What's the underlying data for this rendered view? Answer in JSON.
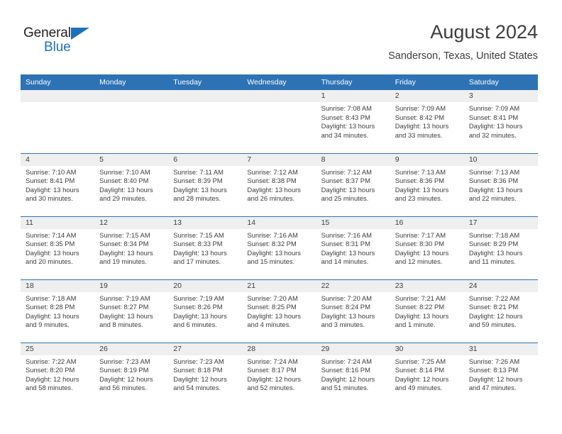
{
  "logo": {
    "word1": "General",
    "word2": "Blue",
    "triangle_color": "#1d70b8"
  },
  "header": {
    "title": "August 2024",
    "location": "Sanderson, Texas, United States"
  },
  "theme": {
    "header_blue": "#2d72b5",
    "daynum_band": "#efefef",
    "text": "#3d3d3d"
  },
  "weekday_headers": [
    "Sunday",
    "Monday",
    "Tuesday",
    "Wednesday",
    "Thursday",
    "Friday",
    "Saturday"
  ],
  "labels": {
    "sunrise_prefix": "Sunrise:",
    "sunset_prefix": "Sunset:",
    "daylight_prefix": "Daylight:"
  },
  "weeks": [
    [
      {
        "day": "",
        "empty": true
      },
      {
        "day": "",
        "empty": true
      },
      {
        "day": "",
        "empty": true
      },
      {
        "day": "",
        "empty": true
      },
      {
        "day": "1",
        "sunrise": "Sunrise: 7:08 AM",
        "sunset": "Sunset: 8:43 PM",
        "daylight": "Daylight: 13 hours and 34 minutes."
      },
      {
        "day": "2",
        "sunrise": "Sunrise: 7:09 AM",
        "sunset": "Sunset: 8:42 PM",
        "daylight": "Daylight: 13 hours and 33 minutes."
      },
      {
        "day": "3",
        "sunrise": "Sunrise: 7:09 AM",
        "sunset": "Sunset: 8:41 PM",
        "daylight": "Daylight: 13 hours and 32 minutes."
      }
    ],
    [
      {
        "day": "4",
        "sunrise": "Sunrise: 7:10 AM",
        "sunset": "Sunset: 8:41 PM",
        "daylight": "Daylight: 13 hours and 30 minutes."
      },
      {
        "day": "5",
        "sunrise": "Sunrise: 7:10 AM",
        "sunset": "Sunset: 8:40 PM",
        "daylight": "Daylight: 13 hours and 29 minutes."
      },
      {
        "day": "6",
        "sunrise": "Sunrise: 7:11 AM",
        "sunset": "Sunset: 8:39 PM",
        "daylight": "Daylight: 13 hours and 28 minutes."
      },
      {
        "day": "7",
        "sunrise": "Sunrise: 7:12 AM",
        "sunset": "Sunset: 8:38 PM",
        "daylight": "Daylight: 13 hours and 26 minutes."
      },
      {
        "day": "8",
        "sunrise": "Sunrise: 7:12 AM",
        "sunset": "Sunset: 8:37 PM",
        "daylight": "Daylight: 13 hours and 25 minutes."
      },
      {
        "day": "9",
        "sunrise": "Sunrise: 7:13 AM",
        "sunset": "Sunset: 8:36 PM",
        "daylight": "Daylight: 13 hours and 23 minutes."
      },
      {
        "day": "10",
        "sunrise": "Sunrise: 7:13 AM",
        "sunset": "Sunset: 8:36 PM",
        "daylight": "Daylight: 13 hours and 22 minutes."
      }
    ],
    [
      {
        "day": "11",
        "sunrise": "Sunrise: 7:14 AM",
        "sunset": "Sunset: 8:35 PM",
        "daylight": "Daylight: 13 hours and 20 minutes."
      },
      {
        "day": "12",
        "sunrise": "Sunrise: 7:15 AM",
        "sunset": "Sunset: 8:34 PM",
        "daylight": "Daylight: 13 hours and 19 minutes."
      },
      {
        "day": "13",
        "sunrise": "Sunrise: 7:15 AM",
        "sunset": "Sunset: 8:33 PM",
        "daylight": "Daylight: 13 hours and 17 minutes."
      },
      {
        "day": "14",
        "sunrise": "Sunrise: 7:16 AM",
        "sunset": "Sunset: 8:32 PM",
        "daylight": "Daylight: 13 hours and 15 minutes."
      },
      {
        "day": "15",
        "sunrise": "Sunrise: 7:16 AM",
        "sunset": "Sunset: 8:31 PM",
        "daylight": "Daylight: 13 hours and 14 minutes."
      },
      {
        "day": "16",
        "sunrise": "Sunrise: 7:17 AM",
        "sunset": "Sunset: 8:30 PM",
        "daylight": "Daylight: 13 hours and 12 minutes."
      },
      {
        "day": "17",
        "sunrise": "Sunrise: 7:18 AM",
        "sunset": "Sunset: 8:29 PM",
        "daylight": "Daylight: 13 hours and 11 minutes."
      }
    ],
    [
      {
        "day": "18",
        "sunrise": "Sunrise: 7:18 AM",
        "sunset": "Sunset: 8:28 PM",
        "daylight": "Daylight: 13 hours and 9 minutes."
      },
      {
        "day": "19",
        "sunrise": "Sunrise: 7:19 AM",
        "sunset": "Sunset: 8:27 PM",
        "daylight": "Daylight: 13 hours and 8 minutes."
      },
      {
        "day": "20",
        "sunrise": "Sunrise: 7:19 AM",
        "sunset": "Sunset: 8:26 PM",
        "daylight": "Daylight: 13 hours and 6 minutes."
      },
      {
        "day": "21",
        "sunrise": "Sunrise: 7:20 AM",
        "sunset": "Sunset: 8:25 PM",
        "daylight": "Daylight: 13 hours and 4 minutes."
      },
      {
        "day": "22",
        "sunrise": "Sunrise: 7:20 AM",
        "sunset": "Sunset: 8:24 PM",
        "daylight": "Daylight: 13 hours and 3 minutes."
      },
      {
        "day": "23",
        "sunrise": "Sunrise: 7:21 AM",
        "sunset": "Sunset: 8:22 PM",
        "daylight": "Daylight: 13 hours and 1 minute."
      },
      {
        "day": "24",
        "sunrise": "Sunrise: 7:22 AM",
        "sunset": "Sunset: 8:21 PM",
        "daylight": "Daylight: 12 hours and 59 minutes."
      }
    ],
    [
      {
        "day": "25",
        "sunrise": "Sunrise: 7:22 AM",
        "sunset": "Sunset: 8:20 PM",
        "daylight": "Daylight: 12 hours and 58 minutes."
      },
      {
        "day": "26",
        "sunrise": "Sunrise: 7:23 AM",
        "sunset": "Sunset: 8:19 PM",
        "daylight": "Daylight: 12 hours and 56 minutes."
      },
      {
        "day": "27",
        "sunrise": "Sunrise: 7:23 AM",
        "sunset": "Sunset: 8:18 PM",
        "daylight": "Daylight: 12 hours and 54 minutes."
      },
      {
        "day": "28",
        "sunrise": "Sunrise: 7:24 AM",
        "sunset": "Sunset: 8:17 PM",
        "daylight": "Daylight: 12 hours and 52 minutes."
      },
      {
        "day": "29",
        "sunrise": "Sunrise: 7:24 AM",
        "sunset": "Sunset: 8:16 PM",
        "daylight": "Daylight: 12 hours and 51 minutes."
      },
      {
        "day": "30",
        "sunrise": "Sunrise: 7:25 AM",
        "sunset": "Sunset: 8:14 PM",
        "daylight": "Daylight: 12 hours and 49 minutes."
      },
      {
        "day": "31",
        "sunrise": "Sunrise: 7:26 AM",
        "sunset": "Sunset: 8:13 PM",
        "daylight": "Daylight: 12 hours and 47 minutes."
      }
    ]
  ]
}
